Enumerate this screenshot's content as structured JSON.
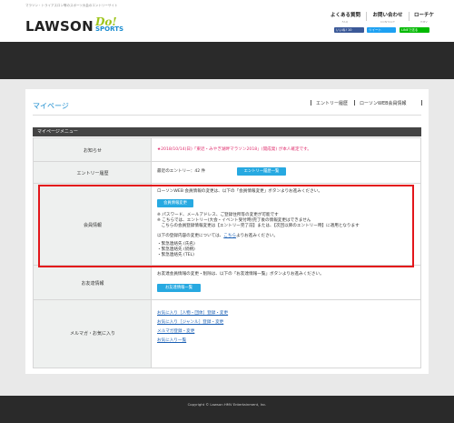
{
  "header": {
    "tagline": "マラソン・トライアスロン等のスポーツ大会のエントリーサイト",
    "logo_main": "LAWSON",
    "logo_do": "Do!",
    "logo_sports": "SPORTS",
    "nav": [
      {
        "title": "よくある質問",
        "sub": "FAQ"
      },
      {
        "title": "お問い合わせ",
        "sub": "CONTACT"
      },
      {
        "title": "ローチケ",
        "sub": "HMV"
      }
    ],
    "social": [
      {
        "label": "いいね! 10",
        "color": "#3b5998"
      },
      {
        "label": "ツイート",
        "color": "#1da1f2"
      },
      {
        "label": "LINEで送る",
        "color": "#00b900"
      }
    ]
  },
  "page": {
    "title": "マイページ",
    "top_links": [
      "エントリー履歴",
      "ローソンWEB会員情報"
    ],
    "menu_heading": "マイページメニュー"
  },
  "rows": {
    "notice": {
      "label": "お知らせ",
      "text": "★2018/10/14(日)「東近・みやぎ湖畔マラソン2018」(開成発) が本人確定です。"
    },
    "entry": {
      "label": "エントリー履歴",
      "text": "最近のエントリー：42 件",
      "button": "エントリー履歴一覧"
    },
    "member": {
      "label": "会員情報",
      "intro": "ローソンWEB 会員情報の変更は、以下の「会員情報変更」ボタンよりお進みください。",
      "button": "会員情報変更",
      "notes": [
        "※ パスワード、メールアドレス、ご登録住所等の変更が可能です",
        "※ こちらでは、エントリー(大会・イベント受付時)完了後の情報変更はできません",
        "　こちらの会員登録情報変更は【エントリー完了前】または、【次回以降のエントリー時】に適用となります"
      ],
      "link_line_prefix": "以下の登録内容の変更については、",
      "link_line_link": "こちら",
      "link_line_suffix": "よりお進みください。",
      "bullets": [
        "・緊急連絡先 (氏名)",
        "・緊急連絡先 (続柄)",
        "・緊急連絡先 (TEL)"
      ]
    },
    "friends": {
      "label": "お友達情報",
      "text": "お友達会員情報の変更・削除は、以下の「お友達情報一覧」ボタンよりお進みください。",
      "button": "お友達情報一覧"
    },
    "favorites": {
      "label": "メルマガ・お気に入り",
      "links": [
        "お気に入り［人物・団体］登録・変更",
        "お気に入り［ジャンル］登録・変更",
        "メルマガ登録・変更",
        "お気に入り一覧"
      ]
    }
  },
  "footer": {
    "copyright": "Copyright © Lawson HMV Entertainment, Inc."
  }
}
